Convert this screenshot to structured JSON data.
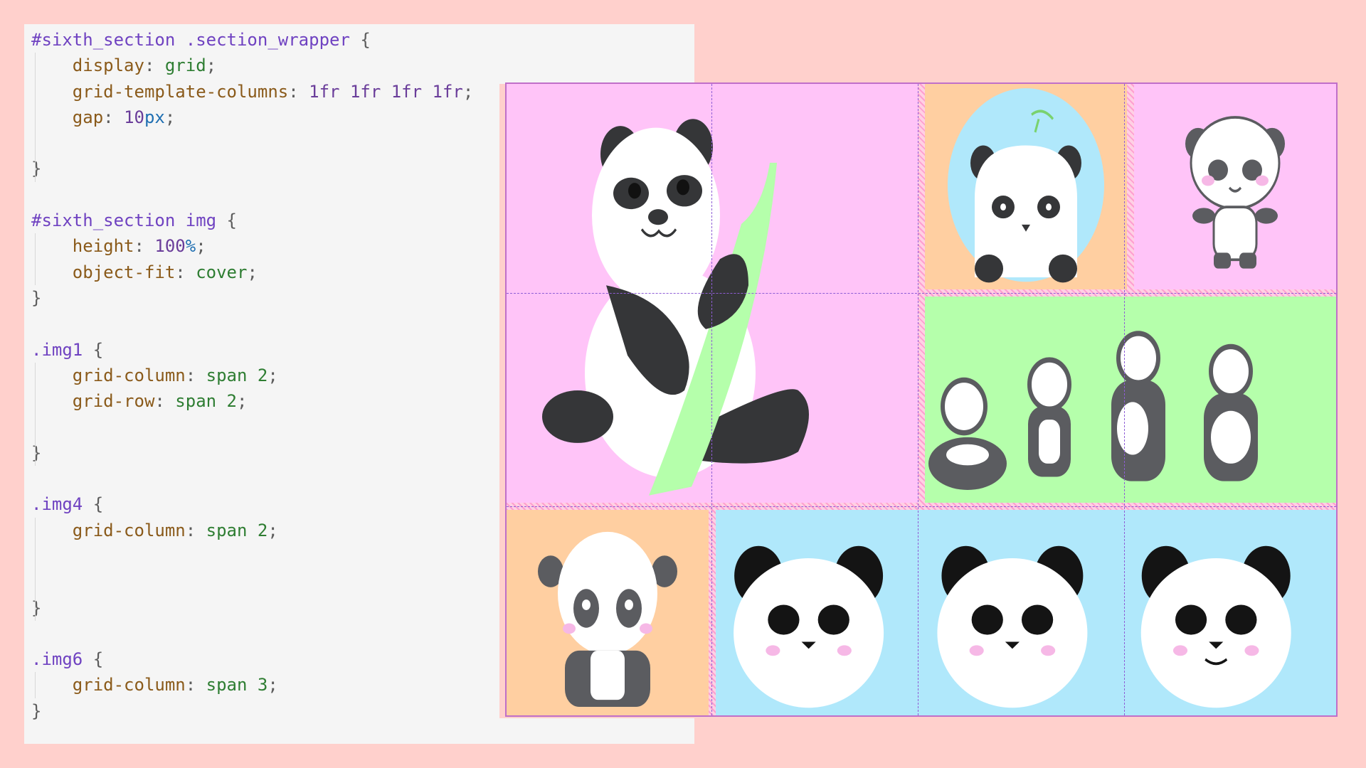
{
  "code": {
    "lines": [
      [
        [
          "c-sel",
          "#sixth_section .section_wrapper "
        ],
        [
          "c-punc",
          "{"
        ]
      ],
      [
        [
          "c-punc",
          "    "
        ],
        [
          "c-prop",
          "display"
        ],
        [
          "c-punc",
          ": "
        ],
        [
          "c-val",
          "grid"
        ],
        [
          "c-punc",
          ";"
        ]
      ],
      [
        [
          "c-punc",
          "    "
        ],
        [
          "c-prop",
          "grid-template-columns"
        ],
        [
          "c-punc",
          ": "
        ],
        [
          "c-num",
          "1fr 1fr 1fr 1fr"
        ],
        [
          "c-punc",
          ";"
        ]
      ],
      [
        [
          "c-punc",
          "    "
        ],
        [
          "c-prop",
          "gap"
        ],
        [
          "c-punc",
          ": "
        ],
        [
          "c-num",
          "10"
        ],
        [
          "c-unit",
          "px"
        ],
        [
          "c-punc",
          ";"
        ]
      ],
      [],
      [
        [
          "c-punc",
          "}"
        ]
      ],
      [],
      [
        [
          "c-sel",
          "#sixth_section img "
        ],
        [
          "c-punc",
          "{"
        ]
      ],
      [
        [
          "c-punc",
          "    "
        ],
        [
          "c-prop",
          "height"
        ],
        [
          "c-punc",
          ": "
        ],
        [
          "c-num",
          "100"
        ],
        [
          "c-unit",
          "%"
        ],
        [
          "c-punc",
          ";"
        ]
      ],
      [
        [
          "c-punc",
          "    "
        ],
        [
          "c-prop",
          "object-fit"
        ],
        [
          "c-punc",
          ": "
        ],
        [
          "c-val",
          "cover"
        ],
        [
          "c-punc",
          ";"
        ]
      ],
      [
        [
          "c-punc",
          "}"
        ]
      ],
      [],
      [
        [
          "c-sel",
          ".img1 "
        ],
        [
          "c-punc",
          "{"
        ]
      ],
      [
        [
          "c-punc",
          "    "
        ],
        [
          "c-prop",
          "grid-column"
        ],
        [
          "c-punc",
          ": "
        ],
        [
          "c-val",
          "span 2"
        ],
        [
          "c-punc",
          ";"
        ]
      ],
      [
        [
          "c-punc",
          "    "
        ],
        [
          "c-prop",
          "grid-row"
        ],
        [
          "c-punc",
          ": "
        ],
        [
          "c-val",
          "span 2"
        ],
        [
          "c-punc",
          ";"
        ]
      ],
      [],
      [
        [
          "c-punc",
          "}"
        ]
      ],
      [],
      [
        [
          "c-sel",
          ".img4 "
        ],
        [
          "c-punc",
          "{"
        ]
      ],
      [
        [
          "c-punc",
          "    "
        ],
        [
          "c-prop",
          "grid-column"
        ],
        [
          "c-punc",
          ": "
        ],
        [
          "c-val",
          "span 2"
        ],
        [
          "c-punc",
          ";"
        ]
      ],
      [],
      [],
      [
        [
          "c-punc",
          "}"
        ]
      ],
      [],
      [
        [
          "c-sel",
          ".img6 "
        ],
        [
          "c-punc",
          "{"
        ]
      ],
      [
        [
          "c-punc",
          "    "
        ],
        [
          "c-prop",
          "grid-column"
        ],
        [
          "c-punc",
          ": "
        ],
        [
          "c-val",
          "span 3"
        ],
        [
          "c-punc",
          ";"
        ]
      ],
      [
        [
          "c-punc",
          "}"
        ]
      ]
    ],
    "guide_lines": [
      1,
      2,
      3,
      4,
      5,
      8,
      9,
      13,
      14,
      15,
      16,
      19,
      20,
      21,
      22,
      25
    ]
  },
  "grid_preview": {
    "tiles": [
      {
        "class": "img1",
        "name": "panda-with-bamboo-image",
        "bg": "#ffc4f8"
      },
      {
        "class": "img2",
        "name": "panda-peeking-circle-image",
        "bg": "#ffcfa1"
      },
      {
        "class": "img3",
        "name": "standing-panda-image",
        "bg": "#ffc4f8"
      },
      {
        "class": "img4",
        "name": "four-pandas-image",
        "bg": "#b5ffab"
      },
      {
        "class": "img5",
        "name": "sitting-baby-panda-image",
        "bg": "#ffcfa1"
      },
      {
        "class": "img6",
        "name": "three-panda-faces-image",
        "bg": "#b0e8fb"
      }
    ],
    "colors": {
      "page_bg": "#ffd0cc",
      "code_bg": "#f5f5f5",
      "panda_black": "#353638",
      "panda_gray": "#5b5c60",
      "bamboo": "#b5ffab",
      "blush": "#f6b8e6"
    }
  }
}
